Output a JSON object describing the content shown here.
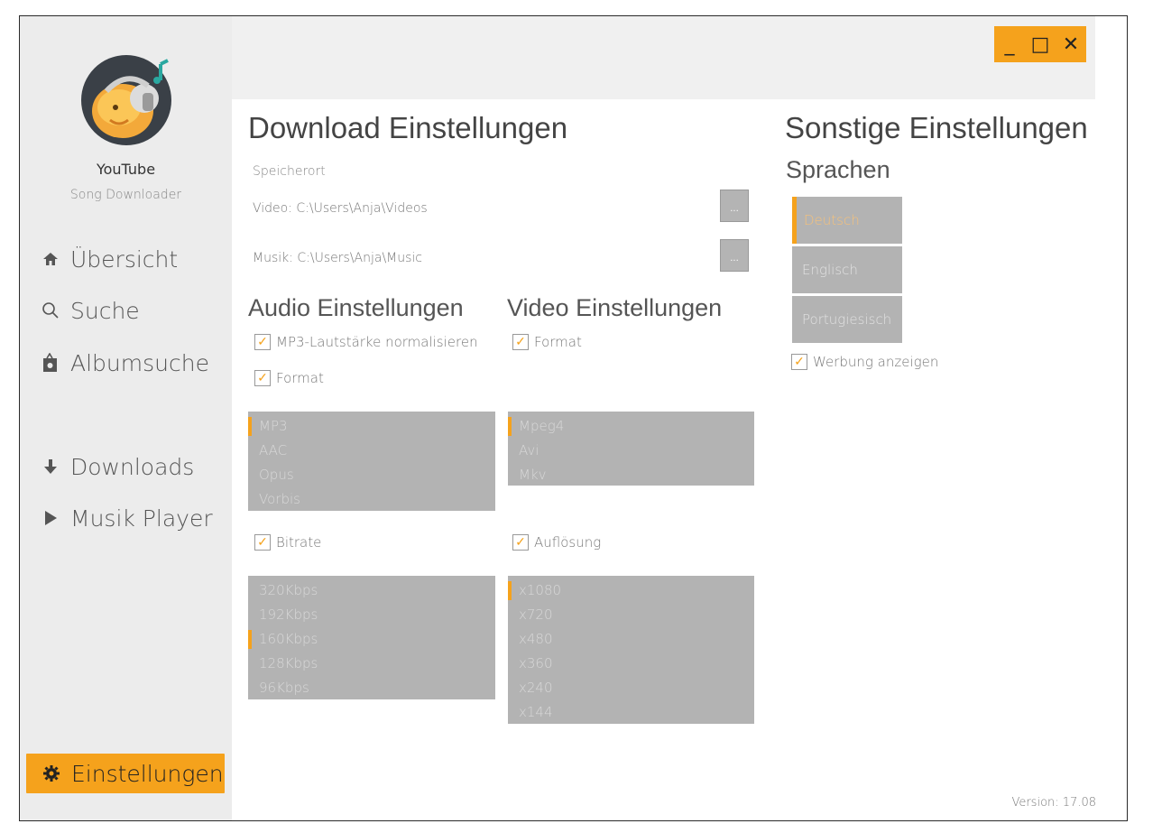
{
  "app": {
    "name": "YouTube",
    "subtitle": "Song Downloader",
    "version": "Version: 17.08"
  },
  "window_controls": {
    "minimize": "_",
    "maximize": "□",
    "close": "✕"
  },
  "nav": {
    "overview": "Übersicht",
    "search": "Suche",
    "album_search": "Albumsuche",
    "downloads": "Downloads",
    "music_player": "Musik Player",
    "settings": "Einstellungen"
  },
  "download_settings": {
    "title": "Download Einstellungen",
    "location_label": "Speicherort",
    "video_path": "Video: C:\\Users\\Anja\\Videos",
    "music_path": "Musik: C:\\Users\\Anja\\Music",
    "browse_label": "..."
  },
  "audio_settings": {
    "title": "Audio Einstellungen",
    "normalize_label": "MP3-Lautstärke normalisieren",
    "format_label": "Format",
    "formats": [
      "MP3",
      "AAC",
      "Opus",
      "Vorbis"
    ],
    "bitrate_label": "Bitrate",
    "bitrates": [
      "320Kbps",
      "192Kbps",
      "160Kbps",
      "128Kbps",
      "96Kbps"
    ]
  },
  "video_settings": {
    "title": "Video Einstellungen",
    "format_label": "Format",
    "formats": [
      "Mpeg4",
      "Avi",
      "Mkv"
    ],
    "resolution_label": "Auflösung",
    "resolutions": [
      "x1080",
      "x720",
      "x480",
      "x360",
      "x240",
      "x144"
    ]
  },
  "other_settings": {
    "title": "Sonstige Einstellungen",
    "languages_title": "Sprachen",
    "languages": [
      "Deutsch",
      "Englisch",
      "Portugiesisch"
    ],
    "ads_label": "Werbung anzeigen"
  },
  "colors": {
    "accent": "#f5a21c",
    "list_bg": "#b3b3b3",
    "sidebar_bg": "#ececec"
  },
  "icons": {
    "overview": "home-icon",
    "search": "search-icon",
    "album_search": "album-icon",
    "downloads": "arrow-down-icon",
    "music_player": "play-icon",
    "settings": "gear-icon"
  }
}
